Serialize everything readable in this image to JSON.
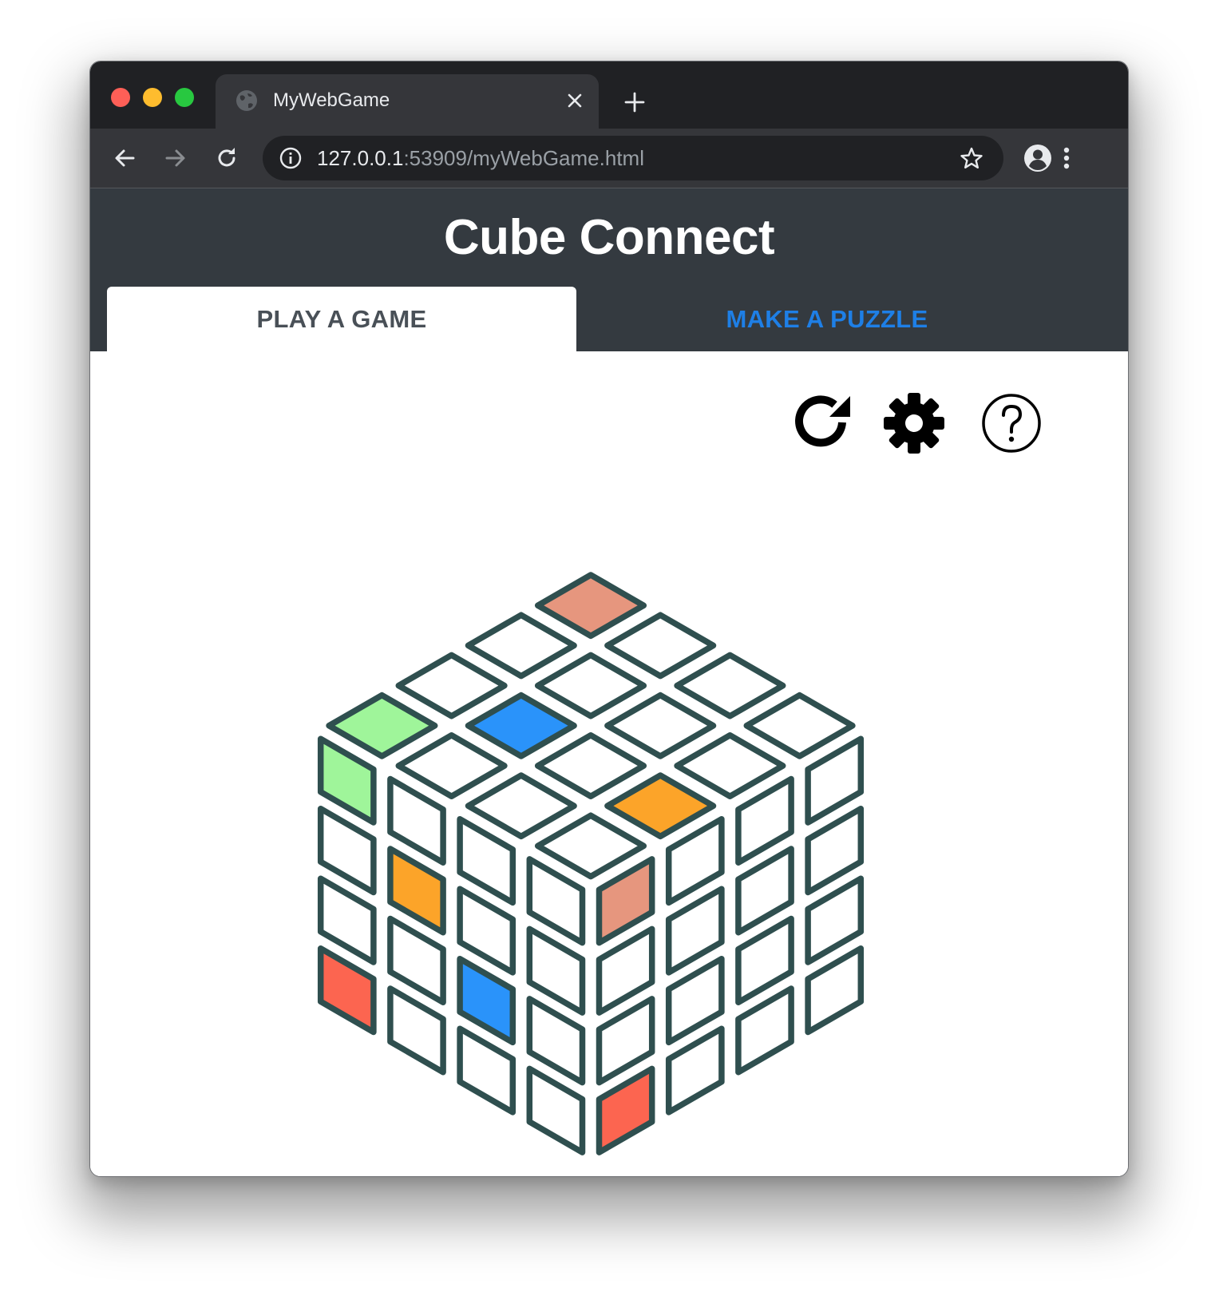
{
  "browser": {
    "tab_title": "MyWebGame",
    "url_host": "127.0.0.1",
    "url_rest": ":53909/myWebGame.html"
  },
  "app": {
    "title": "Cube Connect",
    "tabs": [
      {
        "label": "PLAY A GAME",
        "active": true
      },
      {
        "label": "MAKE A PUZZLE",
        "active": false
      }
    ]
  },
  "controls": {
    "restart": "restart-icon",
    "settings": "gear-icon",
    "help": "help-icon"
  },
  "colors": {
    "outline": "#2f4f4f",
    "empty": "#ffffff",
    "salmon": "#e6967e",
    "green": "#9ff59a",
    "blue": "#2a93fa",
    "orange": "#fca429",
    "red": "#fc6550",
    "tab_inactive_text": "#1e7fe6"
  },
  "cube": {
    "size": 4,
    "top": [
      [
        "salmon",
        "empty",
        "empty",
        "empty"
      ],
      [
        "empty",
        "empty",
        "empty",
        "empty"
      ],
      [
        "empty",
        "blue",
        "empty",
        "orange"
      ],
      [
        "green",
        "empty",
        "empty",
        "empty"
      ]
    ],
    "left": [
      [
        "green",
        "empty",
        "empty",
        "empty"
      ],
      [
        "empty",
        "orange",
        "empty",
        "empty"
      ],
      [
        "empty",
        "empty",
        "blue",
        "empty"
      ],
      [
        "red",
        "empty",
        "empty",
        "empty"
      ]
    ],
    "right": [
      [
        "salmon",
        "empty",
        "empty",
        "empty"
      ],
      [
        "empty",
        "empty",
        "empty",
        "empty"
      ],
      [
        "empty",
        "empty",
        "empty",
        "empty"
      ],
      [
        "red",
        "empty",
        "empty",
        "empty"
      ]
    ]
  }
}
